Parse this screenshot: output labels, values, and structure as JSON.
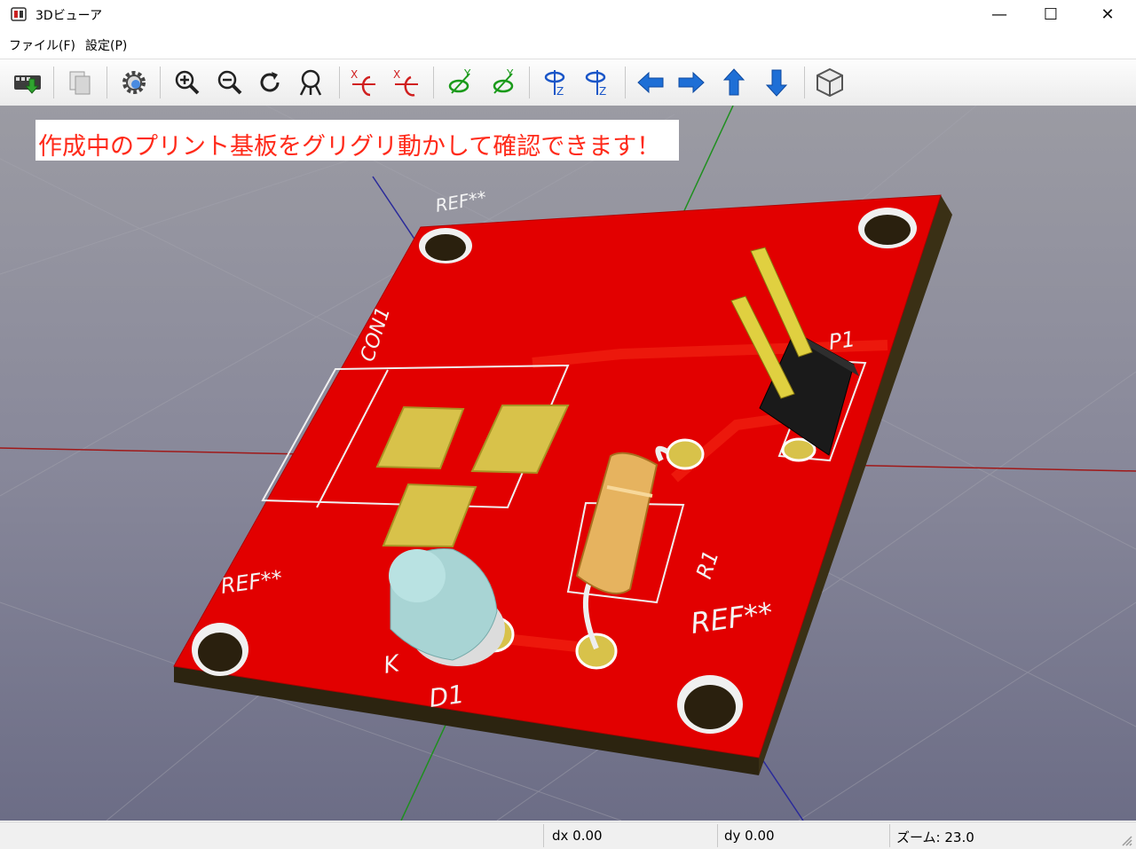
{
  "window": {
    "title": "3Dビューア",
    "minimize": "—",
    "maximize": "☐",
    "close": "✕"
  },
  "menu": [
    {
      "label": "ファイル(F)"
    },
    {
      "label": "設定(P)"
    }
  ],
  "toolbar": {
    "icons": [
      "reload-board-icon",
      "copy-image-icon",
      "settings-gear-icon",
      "zoom-in-icon",
      "zoom-out-icon",
      "redraw-icon",
      "zoom-fit-icon",
      "rotate-x-cw-icon",
      "rotate-x-ccw-icon",
      "rotate-y-cw-icon",
      "rotate-y-ccw-icon",
      "rotate-z-cw-icon",
      "rotate-z-ccw-icon",
      "move-left-icon",
      "move-right-icon",
      "move-up-icon",
      "move-down-icon",
      "orthographic-cube-icon"
    ],
    "accent": "#1e6fd6"
  },
  "viewport": {
    "banner": "作成中のプリント基板をグリグリ動かして確認できます！",
    "banner_color": "#ff2a1a",
    "board_color": "#e00000",
    "labels": {
      "ref_top": "REF**",
      "ref_left": "REF**",
      "ref_right": "REF**",
      "con1": "CON1",
      "p1": "P1",
      "r1": "R1",
      "d1": "D1",
      "k": "K"
    }
  },
  "status": {
    "dx": "dx 0.00",
    "dy": "dy 0.00",
    "zoom": "ズーム: 23.0"
  }
}
